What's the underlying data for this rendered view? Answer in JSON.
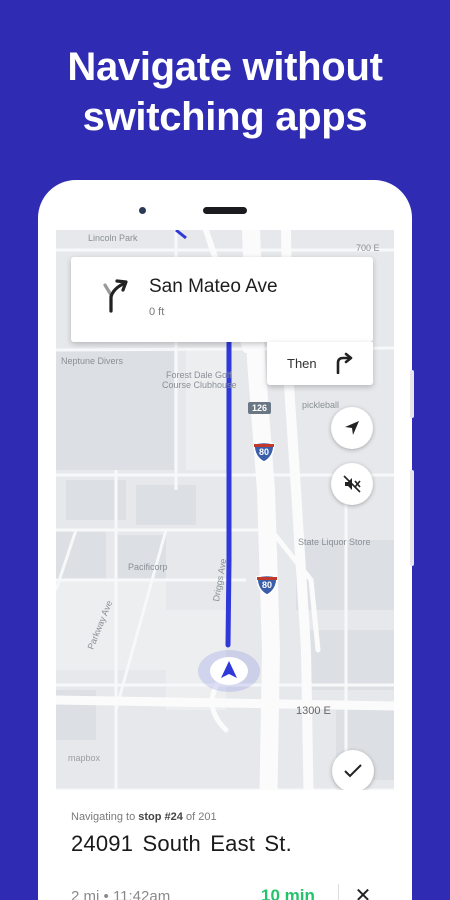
{
  "headline": {
    "line1": "Navigate without",
    "line2": "switching apps"
  },
  "map": {
    "labels": {
      "top_left": "Lincoln Park",
      "top_right": "700 E",
      "neptune": "Neptune Divers",
      "forest": "Forest Dale Golf",
      "forest2": "Course Clubhouse",
      "pickleball": "pickleball",
      "state_liquor": "State Liquor Store",
      "pacificorp": "Pacificorp",
      "parkway": "Parkway Ave",
      "driggs": "Driggs Ave",
      "street_1300": "1300 E"
    },
    "shields": {
      "route126": "126",
      "i80_a": "80",
      "i80_b": "80"
    },
    "attribution": "mapbox"
  },
  "turn": {
    "street": "San Mateo Ave",
    "distance": "0 ft",
    "icon": "turn-right-fork-icon"
  },
  "then": {
    "label": "Then",
    "icon": "turn-right-icon"
  },
  "buttons": {
    "recenter_icon": "navigation-arrow-icon",
    "mute_icon": "volume-off-icon",
    "check_icon": "checkmark-icon"
  },
  "nav": {
    "prefix": "Navigating to",
    "stop": "stop #24",
    "of": "of 201"
  },
  "destination": {
    "address": "24091 South East  St."
  },
  "trip": {
    "distance": "2 mi",
    "arrival": "11:42am",
    "eta": "10 min",
    "close_label": "✕"
  },
  "colors": {
    "brand": "#2f2cb3",
    "route": "#2f38d9",
    "eta": "#22c36a"
  }
}
